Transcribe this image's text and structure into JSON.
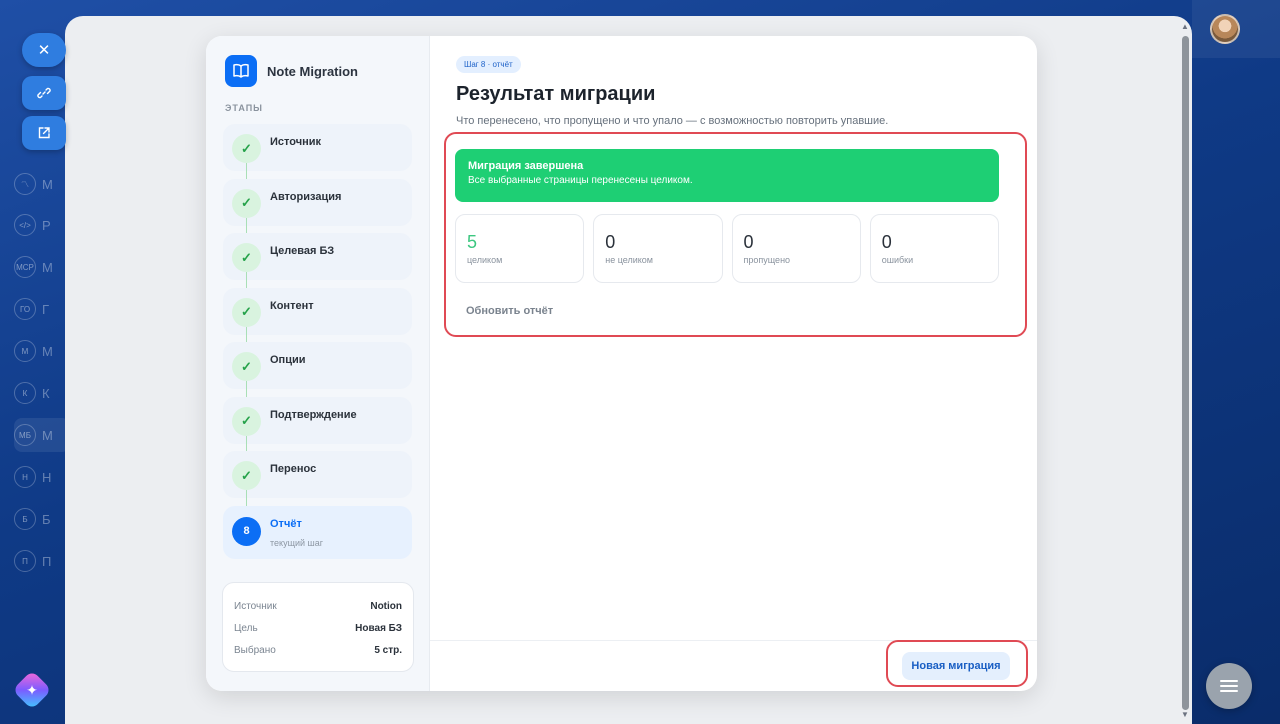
{
  "dialog": {
    "app_title": "Note Migration",
    "stages_label": "ЭТАПЫ",
    "steps": [
      {
        "label": "Источник"
      },
      {
        "label": "Авторизация"
      },
      {
        "label": "Целевая БЗ"
      },
      {
        "label": "Контент"
      },
      {
        "label": "Опции"
      },
      {
        "label": "Подтверждение"
      },
      {
        "label": "Перенос"
      }
    ],
    "step_check": "✓",
    "current_step": {
      "number": "8",
      "label": "Отчёт",
      "sublabel": "текущий шаг"
    },
    "summary": [
      {
        "key": "Источник",
        "value": "Notion"
      },
      {
        "key": "Цель",
        "value": "Новая БЗ"
      },
      {
        "key": "Выбрано",
        "value": "5 стр."
      }
    ]
  },
  "report": {
    "badge": "Шаг 8 · отчёт",
    "title": "Результат миграции",
    "description": "Что перенесено, что пропущено и что упало — с возможностью повторить упавшие.",
    "success_title": "Миграция завершена",
    "success_text": "Все выбранные страницы перенесены целиком.",
    "stats": [
      {
        "value": "5",
        "label": "целиком"
      },
      {
        "value": "0",
        "label": "не целиком"
      },
      {
        "value": "0",
        "label": "пропущено"
      },
      {
        "value": "0",
        "label": "ошибки"
      }
    ],
    "refresh_label": "Обновить отчёт",
    "new_migration_label": "Новая миграция"
  },
  "background": {
    "nav_items": [
      {
        "icon": "",
        "text": "М"
      },
      {
        "icon": "",
        "text": "Р"
      },
      {
        "icon": "MCP",
        "text": "М"
      },
      {
        "icon": "ГО",
        "text": "Г"
      },
      {
        "icon": "М",
        "text": "М"
      },
      {
        "icon": "К",
        "text": "К"
      },
      {
        "icon": "МБ",
        "text": "М"
      },
      {
        "icon": "Н",
        "text": "Н"
      },
      {
        "icon": "Б",
        "text": "Б"
      },
      {
        "icon": "П",
        "text": "П"
      }
    ]
  },
  "colors": {
    "accent": "#0b6ef5",
    "success": "#1ecf74",
    "highlight": "#e04a54"
  }
}
